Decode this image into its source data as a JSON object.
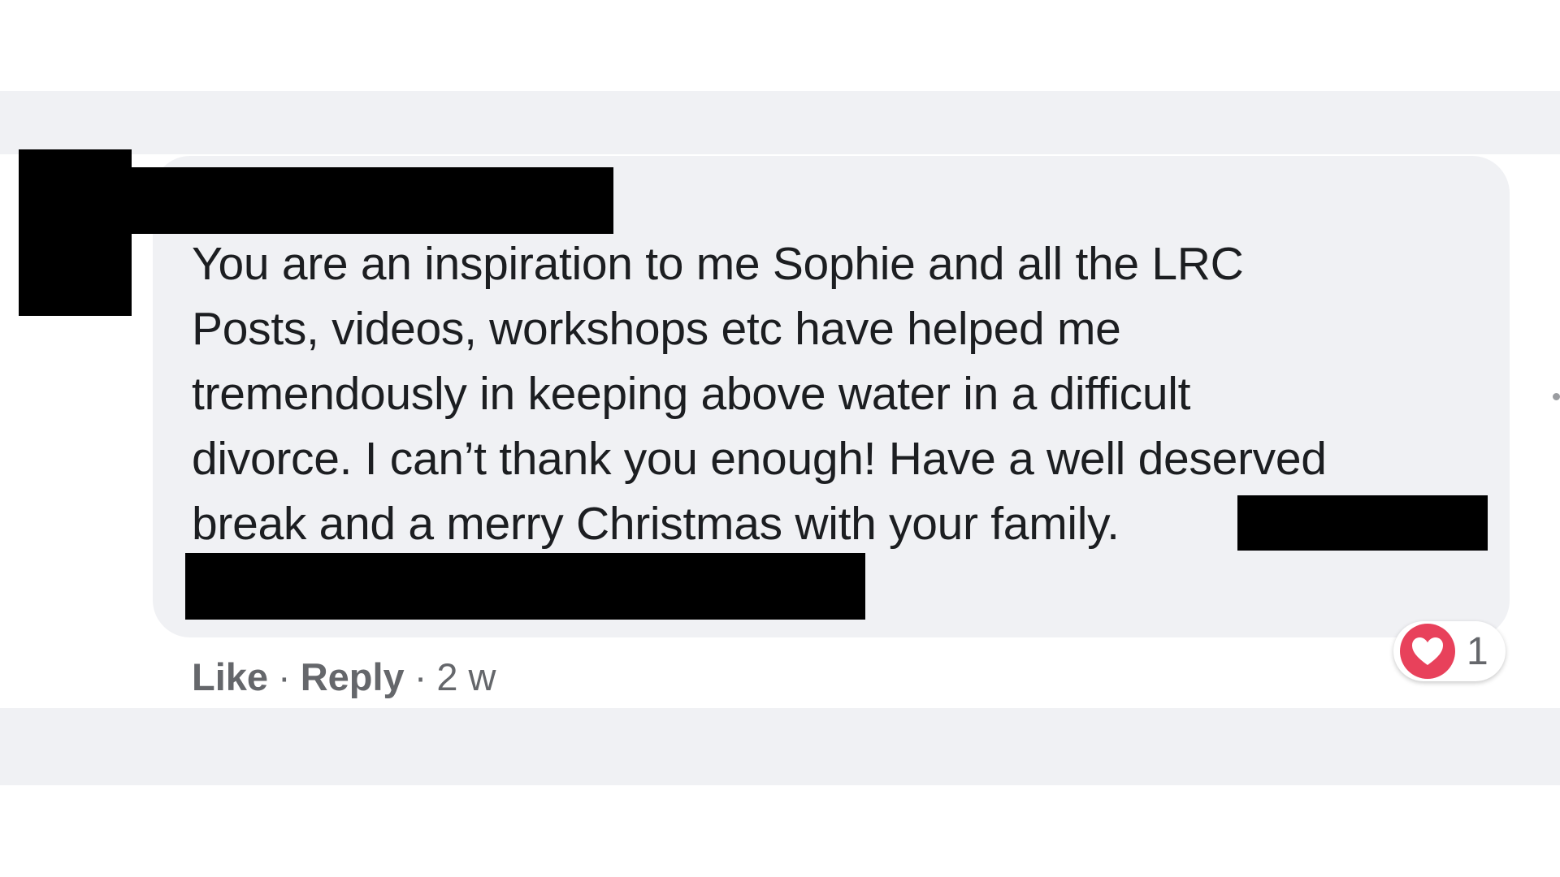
{
  "comment": {
    "lines": [
      "You are an inspiration to me Sophie and all the LRC",
      "Posts, videos, workshops etc have helped me",
      "tremendously in keeping above water in a difficult",
      "divorce. I can’t thank you enough! Have a well deserved",
      "break and a merry Christmas with your family."
    ]
  },
  "actions": {
    "like_label": "Like",
    "reply_label": "Reply",
    "separator": "·",
    "timestamp": "2 w"
  },
  "reaction": {
    "icon": "heart-icon",
    "count": "1"
  },
  "colors": {
    "feed_background": "#f0f1f4",
    "bubble_background": "#f0f1f4",
    "text": "#1c1e21",
    "meta_text": "#65676b",
    "heart": "#e8415b",
    "redaction": "#000000"
  }
}
